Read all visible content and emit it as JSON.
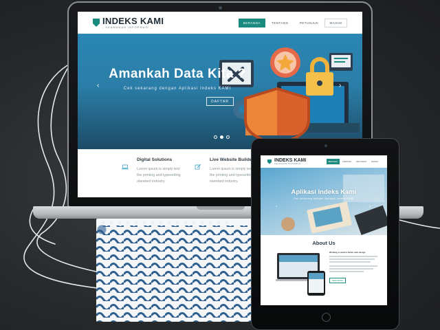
{
  "colors": {
    "accent": "#1b8a7f",
    "hero_blue": "#2a86b3",
    "background": "#26282a"
  },
  "laptop": {
    "header": {
      "logo_icon": "shield-icon",
      "logo_title": "INDEKS KAMI",
      "logo_subtitle": "- KEAMANAN INFORMASI -",
      "nav": [
        "BERANDA",
        "TENTANG",
        "PETUNJUK",
        "MASUK"
      ]
    },
    "hero": {
      "title": "Amankah Data Kita ?",
      "subtitle": "Cek sekarang dengan Aplikasi Indeks KAMI",
      "button": "DAFTAR",
      "prev_icon": "chevron-left-icon",
      "next_icon": "chevron-right-icon",
      "illustration_icons": [
        "tools-icon",
        "star-badge-icon",
        "padlock-icon",
        "shield-icon",
        "monitor-icon"
      ]
    },
    "features": [
      {
        "icon": "laptop-icon",
        "title": "Digital Solutions",
        "lines": [
          "Lorem ipsum is simply text",
          "the printing and typesetting",
          "standard industry."
        ]
      },
      {
        "icon": "edit-icon",
        "title": "Live Website Builder",
        "lines": [
          "Lorem ipsum is simply text",
          "the printing and typesetting",
          "standard industry."
        ]
      }
    ]
  },
  "tablet": {
    "header": {
      "logo_title": "INDEKS KAMI",
      "logo_subtitle": "KEAMANAN INFORMASI",
      "nav": [
        "BERANDA",
        "TENTANG",
        "PETUNJUK",
        "MASUK"
      ]
    },
    "hero": {
      "title": "Aplikasi Indeks Kami",
      "subtitle": "Cek sekarang dengan Aplikasi Indeks KAMI"
    },
    "about": {
      "title": "About Us",
      "heading": "Working to build a better web design",
      "button": "READ MORE"
    }
  }
}
